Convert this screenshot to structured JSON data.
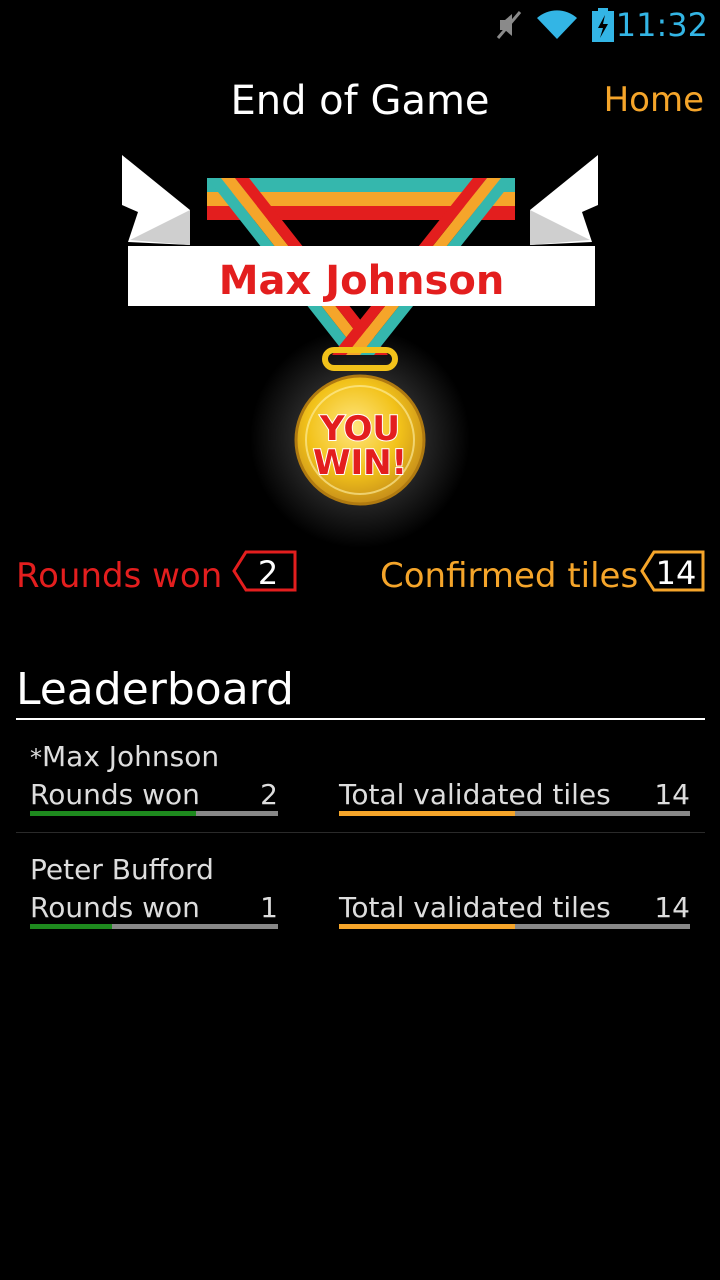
{
  "status_bar": {
    "time": "11:32",
    "icons": [
      "mute-icon",
      "wifi-icon",
      "battery-charging-icon"
    ],
    "time_color": "#33b5e5"
  },
  "header": {
    "title": "End of Game",
    "home_label": "Home"
  },
  "medal": {
    "winner_name": "Max Johnson",
    "medal_text_line1": "YOU",
    "medal_text_line2": "WIN!"
  },
  "stats": {
    "rounds_won_label": "Rounds won",
    "rounds_won_value": "2",
    "confirmed_tiles_label": "Confirmed tiles",
    "confirmed_tiles_value": "14"
  },
  "leaderboard": {
    "title": "Leaderboard",
    "players": [
      {
        "marker": "*",
        "name": "Max Johnson",
        "rounds_label": "Rounds won",
        "rounds_value": "2",
        "rounds_fraction": 0.67,
        "tiles_label": "Total validated tiles",
        "tiles_value": "14",
        "tiles_fraction": 0.5
      },
      {
        "marker": "",
        "name": "Peter Bufford",
        "rounds_label": "Rounds won",
        "rounds_value": "1",
        "rounds_fraction": 0.33,
        "tiles_label": "Total validated tiles",
        "tiles_value": "14",
        "tiles_fraction": 0.5
      }
    ]
  },
  "colors": {
    "red": "#e31e1e",
    "orange": "#f5a52a",
    "green": "#1e8a1e",
    "gold": "#f2c21a"
  }
}
